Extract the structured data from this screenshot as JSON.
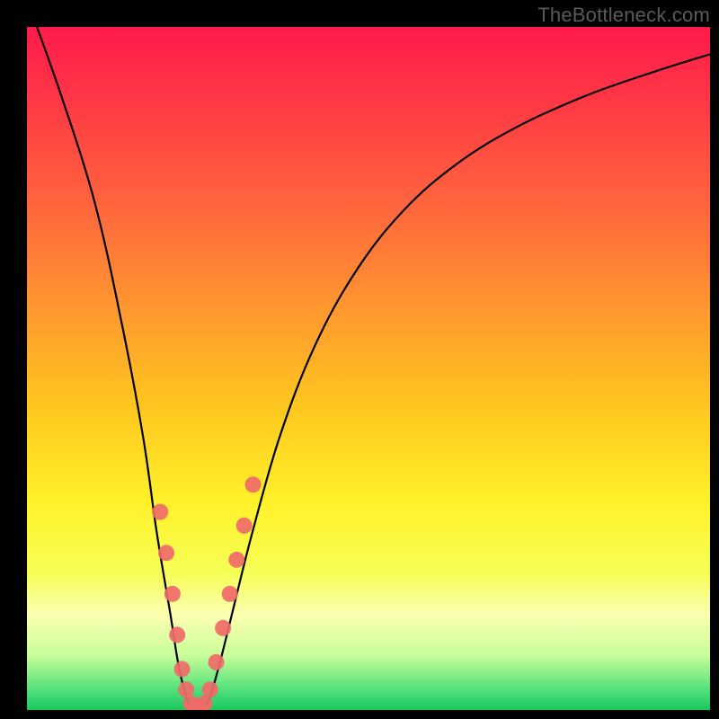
{
  "watermark": "TheBottleneck.com",
  "chart_data": {
    "type": "line",
    "title": "",
    "xlabel": "",
    "ylabel": "",
    "xlim": [
      0,
      100
    ],
    "ylim": [
      0,
      100
    ],
    "series": [
      {
        "name": "bottleneck-curve",
        "x": [
          0,
          5,
          10,
          14,
          17,
          19,
          21,
          22.3,
          23.7,
          25,
          26.4,
          28,
          30,
          33,
          37,
          42,
          48,
          55,
          63,
          72,
          82,
          92,
          100
        ],
        "values": [
          104,
          90,
          74,
          56,
          40,
          26,
          14,
          6,
          1,
          0,
          1,
          6,
          14,
          26,
          40,
          53,
          64,
          73,
          80,
          85.5,
          90,
          93.5,
          96
        ]
      }
    ],
    "markers": {
      "name": "highlight-points",
      "color": "#f06a6a",
      "x": [
        19.5,
        20.4,
        21.3,
        22.0,
        22.7,
        23.3,
        24.0,
        24.6,
        25.3,
        26.0,
        26.8,
        27.7,
        28.7,
        29.7,
        30.7,
        31.8,
        33.1
      ],
      "values": [
        29,
        23,
        17,
        11,
        6,
        3,
        1,
        0.3,
        0.3,
        1,
        3,
        7,
        12,
        17,
        22,
        27,
        33
      ]
    },
    "gradient_stops": [
      {
        "pos": 0,
        "color": "#ff1a4c"
      },
      {
        "pos": 12,
        "color": "#ff3b44"
      },
      {
        "pos": 28,
        "color": "#ff6b3c"
      },
      {
        "pos": 42,
        "color": "#ff9a2e"
      },
      {
        "pos": 56,
        "color": "#ffc81f"
      },
      {
        "pos": 70,
        "color": "#fff22b"
      },
      {
        "pos": 80,
        "color": "#f6ff57"
      },
      {
        "pos": 86,
        "color": "#fdffb0"
      },
      {
        "pos": 92,
        "color": "#c8ff9a"
      },
      {
        "pos": 97,
        "color": "#52e07a"
      },
      {
        "pos": 100,
        "color": "#17c95e"
      }
    ]
  }
}
